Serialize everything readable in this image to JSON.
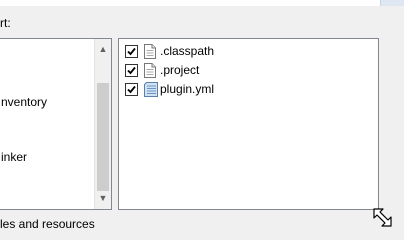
{
  "header": {
    "label": "rt:"
  },
  "left_list": {
    "items": [
      {
        "label": "nventory"
      },
      {
        "label": "inker"
      }
    ]
  },
  "files": [
    {
      "label": ".classpath",
      "checked": true,
      "icon": "text-file-icon"
    },
    {
      "label": ".project",
      "checked": true,
      "icon": "text-file-icon"
    },
    {
      "label": "plugin.yml",
      "checked": true,
      "icon": "yml-file-icon"
    }
  ],
  "footer": {
    "label": "les and resources"
  },
  "scroll_up_glyph": "▲",
  "scroll_down_glyph": "▼"
}
